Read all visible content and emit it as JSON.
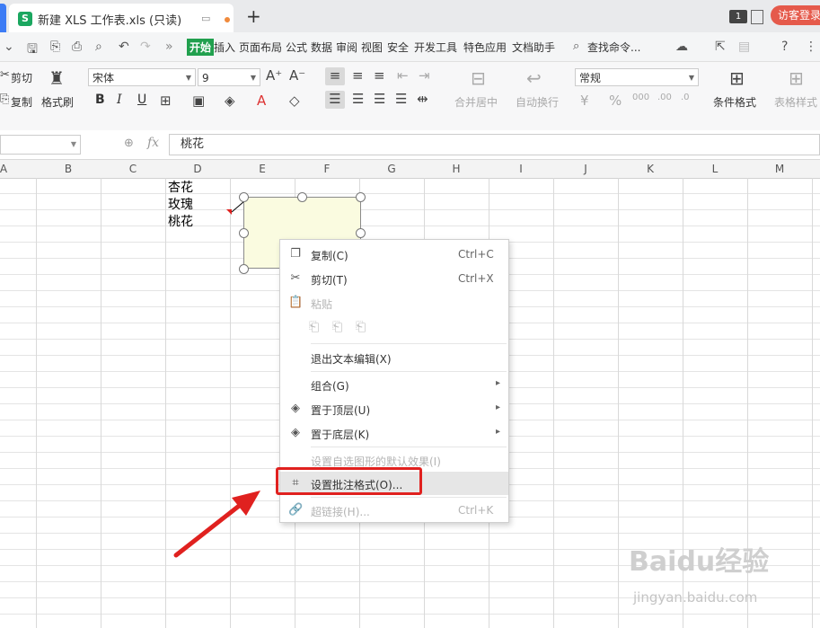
{
  "titlebar": {
    "tab_logo": "S",
    "tab_title": "新建 XLS 工作表.xls (只读)",
    "new_tab": "+",
    "window_count": "1",
    "visitor_login": "访客登录"
  },
  "menubar": {
    "items": [
      "开始",
      "插入",
      "页面布局",
      "公式",
      "数据",
      "审阅",
      "视图",
      "安全",
      "开发工具",
      "特色应用",
      "文档助手"
    ],
    "search": "查找命令..."
  },
  "ribbon": {
    "cut": "剪切",
    "copy": "复制",
    "format_painter": "格式刷",
    "font_name": "宋体",
    "font_size": "9",
    "merge_center": "合并居中",
    "wrap_text": "自动换行",
    "number_format": "常规",
    "conditional_format": "条件格式",
    "table_style": "表格样式",
    "bold": "B",
    "italic": "I",
    "underline": "U"
  },
  "formula": {
    "fx": "fx",
    "content": "桃花"
  },
  "columns": [
    "A",
    "B",
    "C",
    "D",
    "E",
    "F",
    "G",
    "H",
    "I",
    "J",
    "K",
    "L",
    "M"
  ],
  "cells": [
    "杏花",
    "玫瑰",
    "桃花"
  ],
  "context_menu": {
    "items": [
      {
        "label": "复制(C)",
        "shortcut": "Ctrl+C",
        "icon": "copy-icon"
      },
      {
        "label": "剪切(T)",
        "shortcut": "Ctrl+X",
        "icon": "scissors-icon"
      },
      {
        "label": "粘贴",
        "shortcut": "",
        "icon": "paste-icon"
      },
      {
        "label": "退出文本编辑(X)",
        "shortcut": "",
        "icon": ""
      },
      {
        "label": "组合(G)",
        "shortcut": "",
        "icon": ""
      },
      {
        "label": "置于顶层(U)",
        "shortcut": "",
        "icon": "bring-to-front-icon"
      },
      {
        "label": "置于底层(K)",
        "shortcut": "",
        "icon": "send-to-back-icon"
      },
      {
        "label": "设置自选图形的默认效果(I)",
        "shortcut": "",
        "icon": ""
      },
      {
        "label": "设置批注格式(O)...",
        "shortcut": "",
        "icon": "format-comment-icon"
      },
      {
        "label": "超链接(H)...",
        "shortcut": "Ctrl+K",
        "icon": "link-icon"
      }
    ]
  },
  "watermark": {
    "brand": "Baidu经验",
    "url": "jingyan.baidu.com"
  },
  "colors": {
    "accent_green": "#21a04e",
    "highlight_red": "#e0211f",
    "comment_fill": "#fafbe0"
  }
}
